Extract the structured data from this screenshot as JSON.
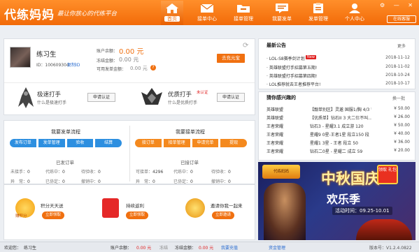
{
  "app": {
    "title": "代练妈妈",
    "slogan": "最让你放心的代练平台",
    "service_button": "在线客服",
    "window_controls": "⚙ — ✕"
  },
  "nav": [
    {
      "label": "首页",
      "icon": "home-icon",
      "active": true
    },
    {
      "label": "接单中心",
      "icon": "envelope-icon"
    },
    {
      "label": "接单管理",
      "icon": "folder-icon"
    },
    {
      "label": "我要发单",
      "icon": "message-icon"
    },
    {
      "label": "发单管理",
      "icon": "clipboard-icon"
    },
    {
      "label": "个人中心",
      "icon": "person-icon"
    }
  ],
  "user": {
    "name": "练习生",
    "id_label": "ID：100609304",
    "copy_link": "复制ID",
    "balance_label": "账户余额：",
    "balance_value": "0.00 元",
    "frozen_label": "冻结金额：",
    "frozen_value": "0.00 元",
    "deposit_label": "可用发单金额：",
    "deposit_value": "0.00 元",
    "recharge_button": "去充元宝"
  },
  "certs": [
    {
      "title": "极速打手",
      "sub": "什么是极速打手",
      "button": "申请认证"
    },
    {
      "title": "优质打手",
      "badge": "未认证",
      "sub": "什么是优质打手",
      "button": "申请认证"
    }
  ],
  "process": {
    "publish_title": "我要发单流程",
    "publish_steps": [
      "发布订单",
      "发单管理",
      "验收",
      "结算"
    ],
    "accept_title": "我要接单流程",
    "accept_steps": [
      "接订单",
      "接单管理",
      "申请完单",
      "提现"
    ]
  },
  "orders": {
    "published_title": "已发订单",
    "published_stats": [
      {
        "label": "未接手：",
        "value": "0"
      },
      {
        "label": "代练中：",
        "value": "0"
      },
      {
        "label": "待验收：",
        "value": "0"
      },
      {
        "label": "异　常：",
        "value": "0"
      },
      {
        "label": "已协定：",
        "value": "0"
      },
      {
        "label": "撤销中：",
        "value": "0"
      }
    ],
    "accepted_title": "已接订单",
    "accepted_stats": [
      {
        "label": "可接单：",
        "value": "4296"
      },
      {
        "label": "代练中：",
        "value": "0"
      },
      {
        "label": "待验收：",
        "value": "0"
      },
      {
        "label": "异　常：",
        "value": "0"
      },
      {
        "label": "已协定：",
        "value": "0"
      },
      {
        "label": "撤销中：",
        "value": "0"
      }
    ]
  },
  "promos": [
    {
      "title": "积分天天送",
      "button": "立即领取",
      "icon_label": "赚积分"
    },
    {
      "title": "持续返利",
      "button": "立即领取"
    },
    {
      "title": "邀请你我一起来",
      "button": "立即邀请"
    }
  ],
  "news": {
    "title": "最新公告",
    "more": "更多",
    "new_badge": "New",
    "items": [
      {
        "title": "· LOL-S8赛季剑计划",
        "date": "2018-11-12"
      },
      {
        "title": "· 英雄联盟打手招募第五期!",
        "date": "2018-11-02"
      },
      {
        "title": "· 英雄联盟打手招募第四期!",
        "date": "2018-10-24"
      },
      {
        "title": "· LOL推荐就去王者推荐平台!",
        "date": "2018-10-17"
      }
    ]
  },
  "recommend": {
    "title": "猜你感兴趣的",
    "switch": "换一批",
    "items": [
      {
        "game": "英雄联盟",
        "title": "【靓单别区】灵遨 国服1/胸 4/3 钻...",
        "price": "¥ 50.00"
      },
      {
        "game": "英雄联盟",
        "title": "【优质单】钻石II 3 大二仕不叫...",
        "price": "¥ 26.00"
      },
      {
        "game": "王者荣耀",
        "title": "钻石3 - 星耀3.1 成立游 120",
        "price": "¥ 50.00"
      },
      {
        "game": "王者荣耀",
        "title": "星耀9 0星-王者1星 段立150 段",
        "price": "¥ 40.00"
      },
      {
        "game": "王者荣耀",
        "title": "星耀1 3星 - 王者 段立 50",
        "price": "¥ 36.00"
      },
      {
        "game": "王者荣耀",
        "title": "钻石二0星 - 星耀二 成立 59",
        "price": "¥ 20.00"
      }
    ]
  },
  "banner": {
    "logo_text": "代练妈妈",
    "title": "中秋国庆",
    "subtitle": "欢乐季",
    "time": "活动时间：09.25-10.01",
    "gift": "领取 礼包"
  },
  "status": {
    "user_label": "欢迎您：",
    "user_value": "练习生",
    "balance_label": "账户余额：",
    "balance_value": "0.00 元",
    "frozen_link": "冻结",
    "frozen_label": "冻结金额：",
    "frozen_value": "0.00 元",
    "recharge_link": "我要充值",
    "fund_link": "资金管理",
    "version": "版本号：V1.2.4.0822"
  },
  "colors": {
    "brand_orange": "#f07010",
    "flow_blue": "#2d8fe0",
    "flow_orange": "#f4891e"
  }
}
